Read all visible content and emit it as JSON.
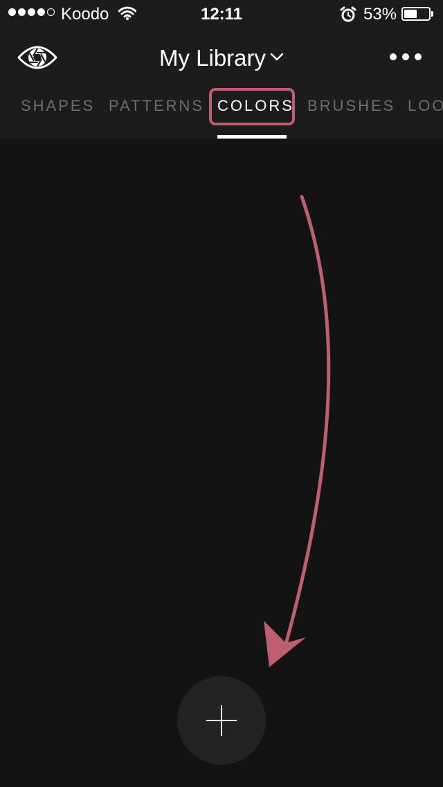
{
  "status_bar": {
    "carrier": "Koodo",
    "time": "12:11",
    "battery_percent": "53%",
    "battery_level": 0.53,
    "signal_bars_filled": 4,
    "signal_bars_total": 5,
    "icons": [
      "wifi-icon",
      "alarm-icon",
      "battery-icon"
    ]
  },
  "header": {
    "title": "My Library",
    "title_icon": "chevron-down-icon",
    "logo_icon": "aperture-eye-icon",
    "more_icon": "more-dots-icon"
  },
  "tabs": [
    {
      "label": "SHAPES",
      "active": false
    },
    {
      "label": "PATTERNS",
      "active": false
    },
    {
      "label": "COLORS",
      "active": true
    },
    {
      "label": "BRUSHES",
      "active": false
    },
    {
      "label": "LOO",
      "active": false
    }
  ],
  "add_button": {
    "icon": "plus-icon"
  },
  "colors": {
    "background": "#131313",
    "header": "#1c1c1c",
    "annotation": "#bd5f6e",
    "inactive_tab": "#6d6d6d",
    "active_tab": "#ffffff",
    "fab": "#232323"
  }
}
